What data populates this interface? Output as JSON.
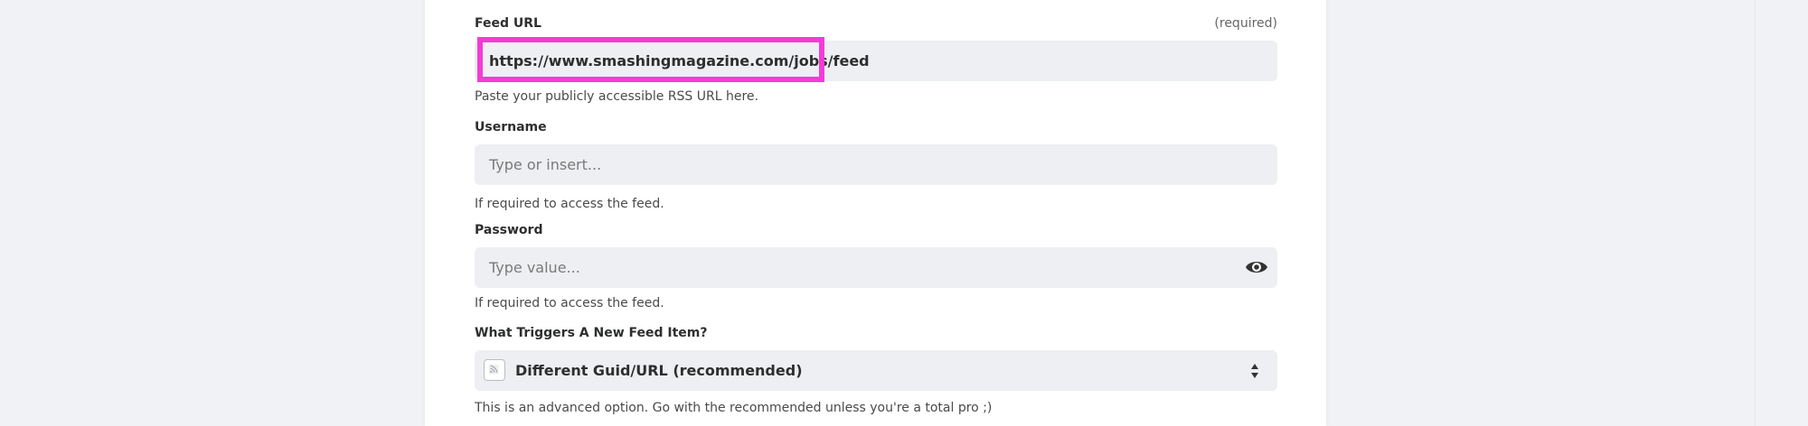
{
  "form": {
    "feed_url": {
      "label": "Feed URL",
      "required_text": "(required)",
      "value": "https://www.smashingmagazine.com/jobs/feed",
      "hint": "Paste your publicly accessible RSS URL here."
    },
    "username": {
      "label": "Username",
      "placeholder": "Type or insert...",
      "hint": "If required to access the feed."
    },
    "password": {
      "label": "Password",
      "placeholder": "Type value...",
      "hint": "If required to access the feed."
    },
    "trigger": {
      "label": "What Triggers A New Feed Item?",
      "selected": "Different Guid/URL (recommended)",
      "hint": "This is an advanced option. Go with the recommended unless you're a total pro ;)"
    }
  },
  "icons": {
    "password_toggle": "eye-icon",
    "select_option": "rss-icon",
    "select_arrows": "up-down-arrows-icon"
  },
  "colors": {
    "highlight": "#f43bd7",
    "input_bg": "#edeff2",
    "page_bg": "#f1f2f5"
  }
}
